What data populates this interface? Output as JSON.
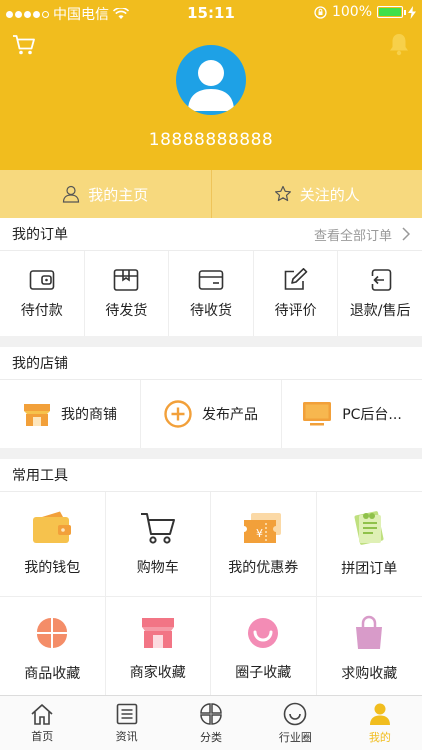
{
  "status": {
    "carrier": "中国电信",
    "time": "15:11",
    "battery": "100%"
  },
  "profile": {
    "phone": "18888888888"
  },
  "top_tabs": [
    {
      "label": "我的主页",
      "icon": "person-icon"
    },
    {
      "label": "关注的人",
      "icon": "star-icon"
    }
  ],
  "orders": {
    "title": "我的订单",
    "view_all": "查看全部订单",
    "items": [
      {
        "label": "待付款",
        "icon": "wallet-outline-icon"
      },
      {
        "label": "待发货",
        "icon": "package-icon"
      },
      {
        "label": "待收货",
        "icon": "card-box-icon"
      },
      {
        "label": "待评价",
        "icon": "edit-icon"
      },
      {
        "label": "退款/售后",
        "icon": "return-icon"
      }
    ]
  },
  "shop": {
    "title": "我的店铺",
    "items": [
      {
        "label": "我的商铺",
        "icon": "storefront-icon"
      },
      {
        "label": "发布产品",
        "icon": "plus-circle-icon"
      },
      {
        "label": "PC后台...",
        "icon": "monitor-icon"
      }
    ]
  },
  "tools": {
    "title": "常用工具",
    "items": [
      {
        "label": "我的钱包",
        "icon": "wallet-icon"
      },
      {
        "label": "购物车",
        "icon": "cart-icon"
      },
      {
        "label": "我的优惠券",
        "icon": "coupon-icon"
      },
      {
        "label": "拼团订单",
        "icon": "group-order-icon"
      },
      {
        "label": "商品收藏",
        "icon": "flower-icon"
      },
      {
        "label": "商家收藏",
        "icon": "shop-fav-icon"
      },
      {
        "label": "圈子收藏",
        "icon": "smile-icon"
      },
      {
        "label": "求购收藏",
        "icon": "bag-icon"
      }
    ]
  },
  "tabbar": [
    {
      "label": "首页",
      "icon": "home-icon"
    },
    {
      "label": "资讯",
      "icon": "news-icon"
    },
    {
      "label": "分类",
      "icon": "category-icon"
    },
    {
      "label": "行业圈",
      "icon": "circle-icon"
    },
    {
      "label": "我的",
      "icon": "user-icon",
      "active": true
    }
  ],
  "colors": {
    "brand": "#f1bd1e",
    "orange": "#f2a03a",
    "blue": "#1ea1e6"
  }
}
